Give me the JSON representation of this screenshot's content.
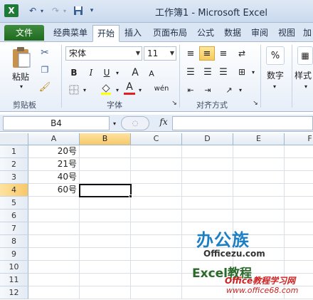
{
  "window": {
    "title": "工作簿1 - Microsoft Excel"
  },
  "quick_access": {
    "save_icon": "save-icon",
    "undo_icon": "undo-icon",
    "redo_icon": "redo-icon",
    "customize_icon": "chevron-down-icon"
  },
  "tabs": [
    {
      "label": "文件"
    },
    {
      "label": "经典菜单"
    },
    {
      "label": "开始"
    },
    {
      "label": "插入"
    },
    {
      "label": "页面布局"
    },
    {
      "label": "公式"
    },
    {
      "label": "数据"
    },
    {
      "label": "审阅"
    },
    {
      "label": "视图"
    },
    {
      "label": "加"
    }
  ],
  "ribbon": {
    "clipboard": {
      "paste_label": "粘贴",
      "group_label": "剪贴板"
    },
    "font": {
      "font_name": "宋体",
      "font_size": "11",
      "group_label": "字体",
      "bold": "B",
      "italic": "I",
      "underline": "U",
      "grow": "A",
      "shrink": "A",
      "font_color": "A",
      "phonetic": "wén"
    },
    "alignment": {
      "group_label": "对齐方式"
    },
    "number": {
      "label": "数字",
      "percent": "%"
    },
    "styles": {
      "label": "样式"
    }
  },
  "formula_bar": {
    "name_box": "B4",
    "fx": "fx",
    "value": ""
  },
  "grid": {
    "columns": [
      "A",
      "B",
      "C",
      "D",
      "E",
      "F"
    ],
    "rows": [
      "1",
      "2",
      "3",
      "4",
      "5",
      "6",
      "7",
      "8",
      "9",
      "10",
      "11",
      "12"
    ],
    "cells": {
      "A1": "20号",
      "A2": "21号",
      "A3": "40号",
      "A4": "60号"
    },
    "active_cell": "B4"
  },
  "watermark": {
    "logo_cn": "办公族",
    "logo_en": "Officezu.com",
    "excel_course": "Excel教程",
    "site_cn": "Office教程学习网",
    "site_url": "www.office68.com"
  }
}
